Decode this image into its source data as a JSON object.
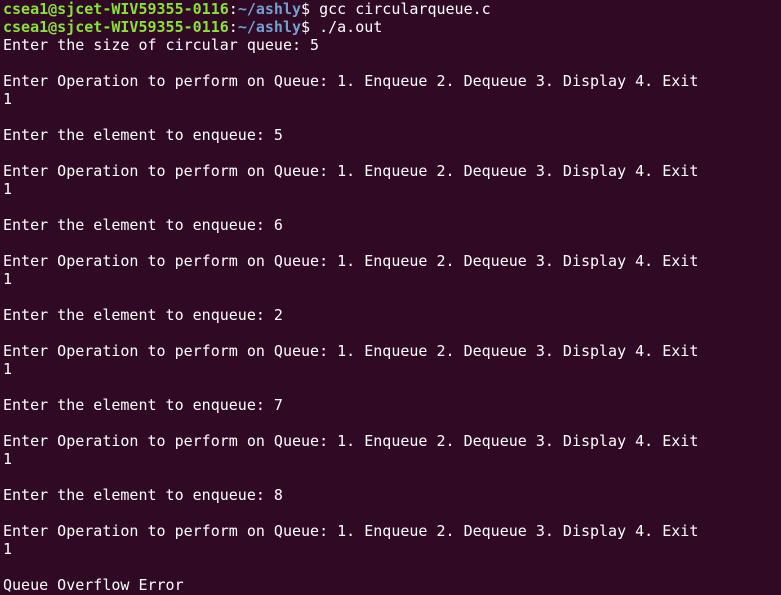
{
  "theme": {
    "background": "#300a24",
    "foreground": "#ffffff",
    "prompt_user_color": "#8ae234",
    "prompt_path_color": "#729fcf"
  },
  "prompt": {
    "user_host": "csea1@sjcet-WIV59355-0116",
    "separator": ":",
    "path": "~/ashly",
    "symbol": "$ "
  },
  "commands": [
    "gcc circularqueue.c",
    "./a.out"
  ],
  "output_lines": [
    "Enter the size of circular queue: 5",
    "",
    "Enter Operation to perform on Queue: 1. Enqueue 2. Dequeue 3. Display 4. Exit",
    "1",
    "",
    "Enter the element to enqueue: 5",
    "",
    "Enter Operation to perform on Queue: 1. Enqueue 2. Dequeue 3. Display 4. Exit",
    "1",
    "",
    "Enter the element to enqueue: 6",
    "",
    "Enter Operation to perform on Queue: 1. Enqueue 2. Dequeue 3. Display 4. Exit",
    "1",
    "",
    "Enter the element to enqueue: 2",
    "",
    "Enter Operation to perform on Queue: 1. Enqueue 2. Dequeue 3. Display 4. Exit",
    "1",
    "",
    "Enter the element to enqueue: 7",
    "",
    "Enter Operation to perform on Queue: 1. Enqueue 2. Dequeue 3. Display 4. Exit",
    "1",
    "",
    "Enter the element to enqueue: 8",
    "",
    "Enter Operation to perform on Queue: 1. Enqueue 2. Dequeue 3. Display 4. Exit",
    "1",
    "",
    "Queue Overflow Error"
  ]
}
